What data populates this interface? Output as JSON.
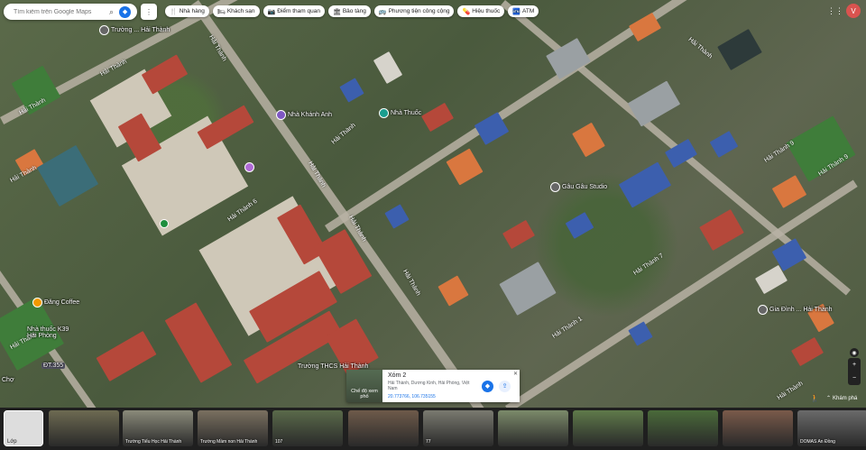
{
  "search": {
    "placeholder": "Tìm kiếm trên Google Maps"
  },
  "chips": [
    {
      "icon": "restaurant-icon",
      "glyph": "🍴",
      "label": "Nhà hàng"
    },
    {
      "icon": "hotel-icon",
      "glyph": "🛏",
      "label": "Khách sạn"
    },
    {
      "icon": "attraction-icon",
      "glyph": "📷",
      "label": "Điểm tham quan"
    },
    {
      "icon": "museum-icon",
      "glyph": "🏛",
      "label": "Bảo tàng"
    },
    {
      "icon": "transit-icon",
      "glyph": "🚌",
      "label": "Phương tiện công cộng"
    },
    {
      "icon": "pharmacy-icon",
      "glyph": "💊",
      "label": "Hiệu thuốc"
    },
    {
      "icon": "atm-icon",
      "glyph": "🏧",
      "label": "ATM"
    }
  ],
  "avatar_letter": "V",
  "map": {
    "streets": [
      "Hải Thành",
      "Hải Thành",
      "Hải Thành",
      "Hải Thành",
      "Hải Thành",
      "Hải Thành 6",
      "Hải Thành",
      "Hải Thành",
      "Hải Thành",
      "Hải Thành",
      "Hải Thành",
      "Hải Thành 7",
      "Hải Thành 9",
      "Hải Thành 9",
      "Hải Thành 1",
      "Hải Thành"
    ],
    "pois": {
      "school_top": "Trường ... Hải Thành",
      "nha_khanh_anh": "Nhà Khánh Anh",
      "nha_thuoc_top": "Nhà Thuốc",
      "dang_coffee": "Đăng Coffee",
      "nha_thuoc_k39": "Nhà thuốc K39\nHải Phòng",
      "gau_gau": "Gâu Gâu Studio",
      "school_bottom": "Trường THCS Hải Thành",
      "right_poi": "Gia Đình ... Hải Thành",
      "cho": "Chợ",
      "road_badge": "ĐT.355"
    }
  },
  "card": {
    "thumb_label": "Chế độ xem phố",
    "title": "Xóm 2",
    "address": "Hải Thành, Dương Kinh, Hải Phòng, Việt Nam",
    "coords": "20.773766, 106.735155"
  },
  "explore_label": "Khám phá",
  "photos": {
    "layers_label": "Lớp",
    "captions": [
      "",
      "Trường Tiểu Học Hải Thành",
      "Trường Mầm non Hải Thành",
      "107",
      "",
      "77",
      "",
      "",
      "",
      "",
      "DOMAS An Đồng"
    ]
  },
  "colors": {
    "accent": "#1a73e8",
    "avatar": "#d9534f"
  }
}
